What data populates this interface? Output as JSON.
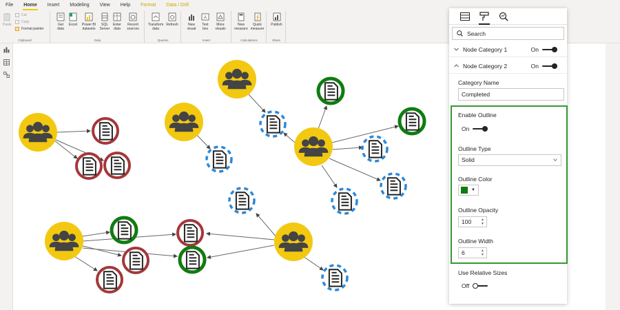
{
  "ribbon": {
    "tabs": [
      "File",
      "Home",
      "Insert",
      "Modeling",
      "View",
      "Help",
      "Format",
      "Data / Drill"
    ],
    "clipboard": {
      "paste": "Paste",
      "cut": "Cut",
      "copy": "Copy",
      "format_painter": "Format painter",
      "label": "Clipboard"
    },
    "data": {
      "get_data": "Get data",
      "excel": "Excel",
      "power_bi": "Power BI datasets",
      "sql": "SQL Server",
      "enter_data": "Enter data",
      "recent_sources": "Recent sources",
      "label": "Data"
    },
    "queries": {
      "transform": "Transform data",
      "refresh": "Refresh",
      "label": "Queries"
    },
    "insert": {
      "new_visual": "New visual",
      "text_box": "Text box",
      "more_visuals": "More visuals",
      "label": "Insert"
    },
    "calculations": {
      "new_measure": "New measure",
      "quick_measure": "Quick measure",
      "label": "Calculations"
    },
    "share": {
      "publish": "Publish",
      "label": "Share"
    }
  },
  "pane": {
    "search_placeholder": "Search",
    "node_category_1": {
      "label": "Node Category 1",
      "toggle": "On"
    },
    "node_category_2": {
      "label": "Node Category 2",
      "toggle": "On"
    },
    "category_name_label": "Category Name",
    "category_name_value": "Completed",
    "enable_outline_label": "Enable Outline",
    "enable_outline_value": "On",
    "outline_type_label": "Outline Type",
    "outline_type_value": "Solid",
    "outline_color_label": "Outline Color",
    "outline_color_value": "#107c10",
    "outline_opacity_label": "Outline Opacity",
    "outline_opacity_value": "100",
    "outline_width_label": "Outline Width",
    "outline_width_value": "6",
    "use_relative_sizes_label": "Use Relative Sizes",
    "use_relative_sizes_value": "Off"
  },
  "colors": {
    "group_node": "#f2c811",
    "outline_red": "#a4373a",
    "outline_green": "#107c10",
    "outline_blue": "#2b88d8",
    "highlight": "#339933"
  },
  "graph": {
    "icons": {
      "group": "people-group-icon",
      "document": "document-icon"
    },
    "outline_kinds": [
      "red",
      "green",
      "blue-dashed"
    ]
  }
}
